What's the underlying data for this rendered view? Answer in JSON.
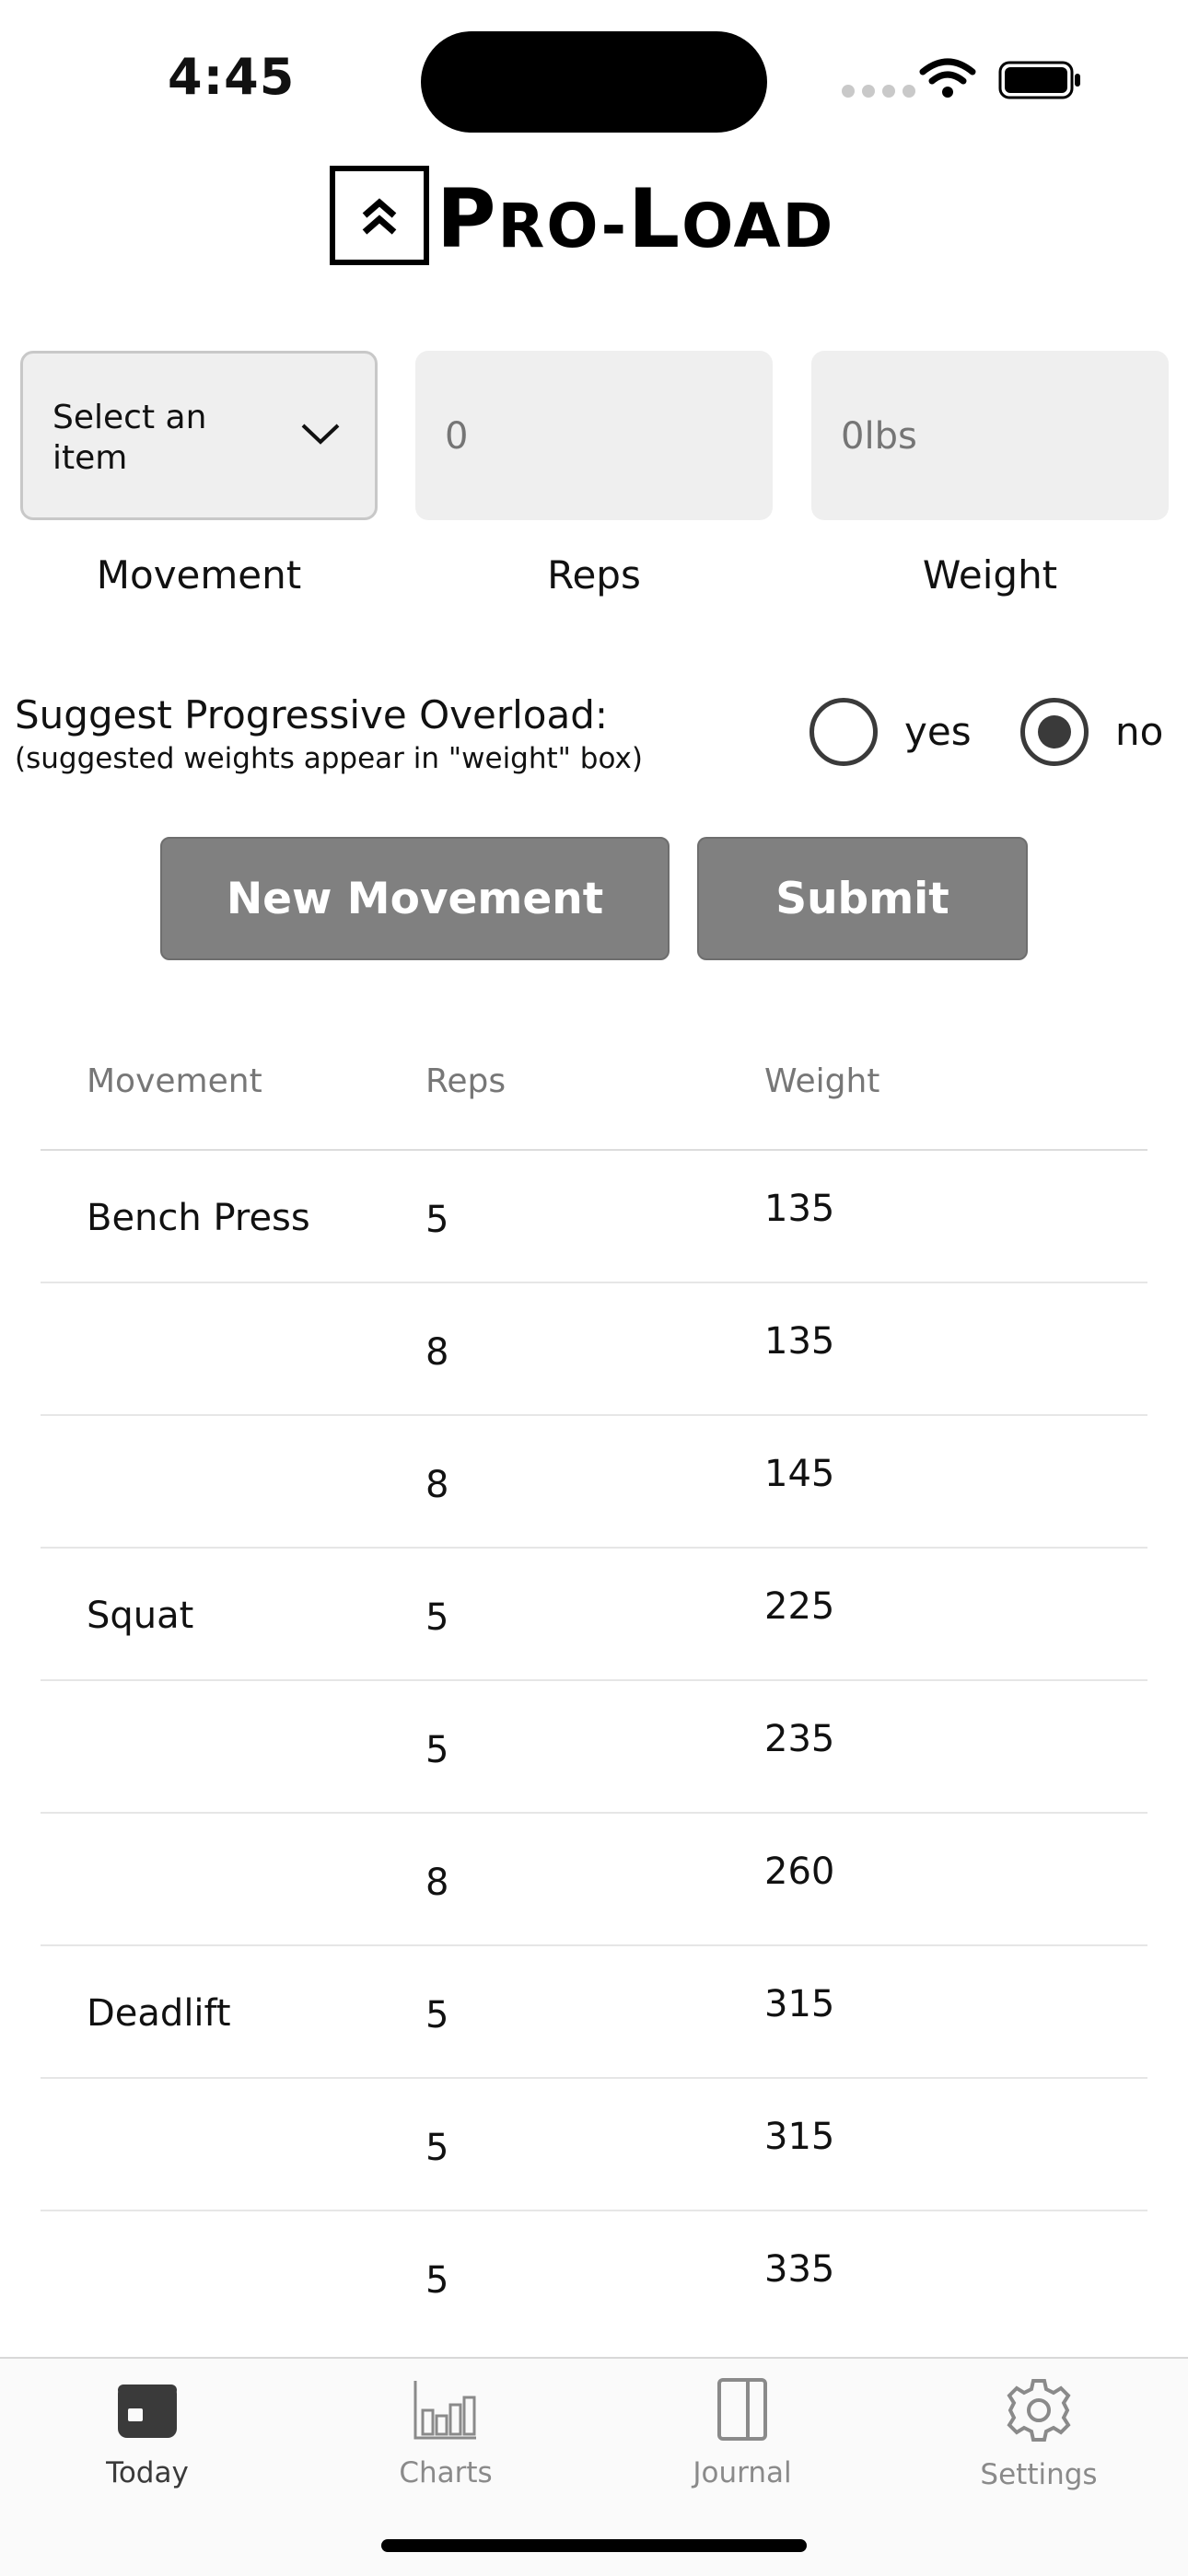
{
  "status_bar": {
    "time": "4:45"
  },
  "app": {
    "logo_text": "Pro-Load",
    "logo_first": "P",
    "logo_rest_a": "RO-",
    "logo_mid": "L",
    "logo_rest_b": "OAD"
  },
  "form": {
    "movement_select": {
      "value": "Select an item",
      "label": "Movement"
    },
    "reps": {
      "placeholder": "0",
      "label": "Reps"
    },
    "weight": {
      "placeholder": "0lbs",
      "label": "Weight"
    }
  },
  "overload": {
    "title": "Suggest Progressive Overload:",
    "subtitle": "(suggested weights appear in \"weight\" box)",
    "options": [
      {
        "label": "yes",
        "selected": false
      },
      {
        "label": "no",
        "selected": true
      }
    ]
  },
  "buttons": {
    "new_movement": "New Movement",
    "submit": "Submit"
  },
  "table": {
    "headers": [
      "Movement",
      "Reps",
      "Weight"
    ],
    "rows": [
      {
        "movement": "Bench Press",
        "reps": "5",
        "weight": "135"
      },
      {
        "movement": "",
        "reps": "8",
        "weight": "135"
      },
      {
        "movement": "",
        "reps": "8",
        "weight": "145"
      },
      {
        "movement": "Squat",
        "reps": "5",
        "weight": "225"
      },
      {
        "movement": "",
        "reps": "5",
        "weight": "235"
      },
      {
        "movement": "",
        "reps": "8",
        "weight": "260"
      },
      {
        "movement": "Deadlift",
        "reps": "5",
        "weight": "315"
      },
      {
        "movement": "",
        "reps": "5",
        "weight": "315"
      },
      {
        "movement": "",
        "reps": "5",
        "weight": "335"
      }
    ]
  },
  "tabbar": {
    "items": [
      {
        "label": "Today",
        "icon": "calendar-icon",
        "active": true
      },
      {
        "label": "Charts",
        "icon": "bar-chart-icon",
        "active": false
      },
      {
        "label": "Journal",
        "icon": "book-icon",
        "active": false
      },
      {
        "label": "Settings",
        "icon": "gear-icon",
        "active": false
      }
    ]
  },
  "colors": {
    "button": "#808080",
    "field_bg": "#efefef",
    "radio": "#3a3a3a",
    "tab_active": "#3a3a3a",
    "tab_inactive": "#8a8a8a"
  }
}
